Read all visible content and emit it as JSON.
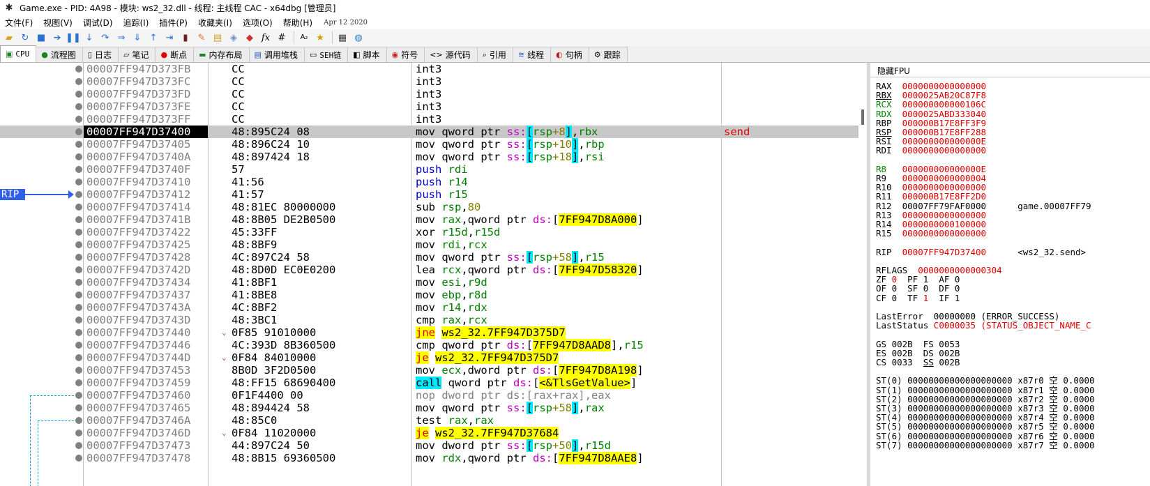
{
  "window": {
    "title": "Game.exe - PID: 4A98 - 模块: ws2_32.dll - 线程: 主线程 CAC - x64dbg [管理员]"
  },
  "menu": {
    "items": [
      "文件(F)",
      "视图(V)",
      "调试(D)",
      "追踪(I)",
      "插件(P)",
      "收藏夹(I)",
      "选项(O)",
      "帮助(H)"
    ],
    "date": "Apr 12 2020"
  },
  "toolbar": {
    "icons": [
      "open-icon",
      "restart-icon",
      "stop-icon",
      "run-icon",
      "pause-icon",
      "step-into-icon",
      "step-over-icon",
      "trace-into-icon",
      "trace-over-icon",
      "run-to-return-icon",
      "run-to-user-icon",
      "patch-icon",
      "comment-icon",
      "label-icon",
      "bookmark-icon",
      "function-icon",
      "hash-icon",
      "font-icon",
      "favourite-icon",
      "calculator-icon",
      "globe-icon"
    ],
    "glyph_fx": "fx",
    "glyph_hash": "#"
  },
  "tabs": [
    {
      "label": "CPU",
      "icon": "cpu-icon",
      "active": true
    },
    {
      "label": "流程图",
      "icon": "graph-icon"
    },
    {
      "label": "日志",
      "icon": "log-icon"
    },
    {
      "label": "笔记",
      "icon": "notes-icon"
    },
    {
      "label": "断点",
      "icon": "breakpoint-icon"
    },
    {
      "label": "内存布局",
      "icon": "memory-icon"
    },
    {
      "label": "调用堆栈",
      "icon": "callstack-icon"
    },
    {
      "label": "SEH链",
      "icon": "seh-icon"
    },
    {
      "label": "脚本",
      "icon": "script-icon"
    },
    {
      "label": "符号",
      "icon": "symbols-icon"
    },
    {
      "label": "源代码",
      "icon": "source-icon"
    },
    {
      "label": "引用",
      "icon": "references-icon"
    },
    {
      "label": "线程",
      "icon": "threads-icon"
    },
    {
      "label": "句柄",
      "icon": "handles-icon"
    },
    {
      "label": "跟踪",
      "icon": "trace-icon"
    }
  ],
  "disasm": {
    "rip_label": "RIP",
    "rows": [
      {
        "addr": "00007FF947D373FB",
        "bytes": "CC",
        "asm": [
          [
            "k-mov",
            "int3"
          ]
        ]
      },
      {
        "addr": "00007FF947D373FC",
        "bytes": "CC",
        "asm": [
          [
            "k-mov",
            "int3"
          ]
        ]
      },
      {
        "addr": "00007FF947D373FD",
        "bytes": "CC",
        "asm": [
          [
            "k-mov",
            "int3"
          ]
        ]
      },
      {
        "addr": "00007FF947D373FE",
        "bytes": "CC",
        "asm": [
          [
            "k-mov",
            "int3"
          ]
        ]
      },
      {
        "addr": "00007FF947D373FF",
        "bytes": "CC",
        "asm": [
          [
            "k-mov",
            "int3"
          ]
        ]
      },
      {
        "addr": "00007FF947D37400",
        "bytes": "48:895C24 08",
        "rip": true,
        "comment": "send",
        "asm": [
          [
            "k-mov",
            "mov qword ptr "
          ],
          [
            "seg",
            "ss:"
          ],
          [
            "brk",
            "["
          ],
          [
            "reg",
            "rsp"
          ],
          [
            "num",
            "+8"
          ],
          [
            "brk",
            "]"
          ],
          [
            "k-mov",
            ","
          ],
          [
            "reg",
            "rbx"
          ]
        ]
      },
      {
        "addr": "00007FF947D37405",
        "bytes": "48:896C24 10",
        "asm": [
          [
            "k-mov",
            "mov qword ptr "
          ],
          [
            "seg",
            "ss:"
          ],
          [
            "brk",
            "["
          ],
          [
            "reg",
            "rsp"
          ],
          [
            "num",
            "+10"
          ],
          [
            "brk",
            "]"
          ],
          [
            "k-mov",
            ","
          ],
          [
            "reg",
            "rbp"
          ]
        ]
      },
      {
        "addr": "00007FF947D3740A",
        "bytes": "48:897424 18",
        "asm": [
          [
            "k-mov",
            "mov qword ptr "
          ],
          [
            "seg",
            "ss:"
          ],
          [
            "brk",
            "["
          ],
          [
            "reg",
            "rsp"
          ],
          [
            "num",
            "+18"
          ],
          [
            "brk",
            "]"
          ],
          [
            "k-mov",
            ","
          ],
          [
            "reg",
            "rsi"
          ]
        ]
      },
      {
        "addr": "00007FF947D3740F",
        "bytes": "57",
        "asm": [
          [
            "k-push",
            "push "
          ],
          [
            "reg",
            "rdi"
          ]
        ]
      },
      {
        "addr": "00007FF947D37410",
        "bytes": "41:56",
        "asm": [
          [
            "k-push",
            "push "
          ],
          [
            "reg",
            "r14"
          ]
        ]
      },
      {
        "addr": "00007FF947D37412",
        "bytes": "41:57",
        "asm": [
          [
            "k-push",
            "push "
          ],
          [
            "reg",
            "r15"
          ]
        ]
      },
      {
        "addr": "00007FF947D37414",
        "bytes": "48:81EC 80000000",
        "asm": [
          [
            "k-mov",
            "sub "
          ],
          [
            "reg",
            "rsp"
          ],
          [
            "k-mov",
            ","
          ],
          [
            "num",
            "80"
          ]
        ]
      },
      {
        "addr": "00007FF947D3741B",
        "bytes": "48:8B05 DE2B0500",
        "asm": [
          [
            "k-mov",
            "mov "
          ],
          [
            "reg",
            "rax"
          ],
          [
            "k-mov",
            ",qword ptr "
          ],
          [
            "seg",
            "ds:"
          ],
          [
            "k-mov",
            "["
          ],
          [
            "yel",
            "7FF947D8A000"
          ],
          [
            "k-mov",
            "]"
          ]
        ]
      },
      {
        "addr": "00007FF947D37422",
        "bytes": "45:33FF",
        "asm": [
          [
            "k-mov",
            "xor "
          ],
          [
            "reg",
            "r15d"
          ],
          [
            "k-mov",
            ","
          ],
          [
            "reg",
            "r15d"
          ]
        ]
      },
      {
        "addr": "00007FF947D37425",
        "bytes": "48:8BF9",
        "asm": [
          [
            "k-mov",
            "mov "
          ],
          [
            "reg",
            "rdi"
          ],
          [
            "k-mov",
            ","
          ],
          [
            "reg",
            "rcx"
          ]
        ]
      },
      {
        "addr": "00007FF947D37428",
        "bytes": "4C:897C24 58",
        "asm": [
          [
            "k-mov",
            "mov qword ptr "
          ],
          [
            "seg",
            "ss:"
          ],
          [
            "brk",
            "["
          ],
          [
            "reg",
            "rsp"
          ],
          [
            "num",
            "+58"
          ],
          [
            "brk",
            "]"
          ],
          [
            "k-mov",
            ","
          ],
          [
            "reg",
            "r15"
          ]
        ]
      },
      {
        "addr": "00007FF947D3742D",
        "bytes": "48:8D0D EC0E0200",
        "asm": [
          [
            "k-mov",
            "lea "
          ],
          [
            "reg",
            "rcx"
          ],
          [
            "k-mov",
            ",qword ptr "
          ],
          [
            "seg",
            "ds:"
          ],
          [
            "k-mov",
            "["
          ],
          [
            "yel",
            "7FF947D58320"
          ],
          [
            "k-mov",
            "]"
          ]
        ]
      },
      {
        "addr": "00007FF947D37434",
        "bytes": "41:8BF1",
        "asm": [
          [
            "k-mov",
            "mov "
          ],
          [
            "reg",
            "esi"
          ],
          [
            "k-mov",
            ","
          ],
          [
            "reg",
            "r9d"
          ]
        ]
      },
      {
        "addr": "00007FF947D37437",
        "bytes": "41:8BE8",
        "asm": [
          [
            "k-mov",
            "mov "
          ],
          [
            "reg",
            "ebp"
          ],
          [
            "k-mov",
            ","
          ],
          [
            "reg",
            "r8d"
          ]
        ]
      },
      {
        "addr": "00007FF947D3743A",
        "bytes": "4C:8BF2",
        "asm": [
          [
            "k-mov",
            "mov "
          ],
          [
            "reg",
            "r14"
          ],
          [
            "k-mov",
            ","
          ],
          [
            "reg",
            "rdx"
          ]
        ]
      },
      {
        "addr": "00007FF947D3743D",
        "bytes": "48:3BC1",
        "asm": [
          [
            "k-mov",
            "cmp "
          ],
          [
            "reg",
            "rax"
          ],
          [
            "k-mov",
            ","
          ],
          [
            "reg",
            "rcx"
          ]
        ]
      },
      {
        "addr": "00007FF947D37440",
        "bytes": "0F85 91010000",
        "jump": true,
        "asm": [
          [
            "k-jmp",
            "jne"
          ],
          [
            "k-dx",
            " "
          ],
          [
            "dest",
            "ws2_32.7FF947D375D7"
          ]
        ]
      },
      {
        "addr": "00007FF947D37446",
        "bytes": "4C:393D 8B360500",
        "asm": [
          [
            "k-mov",
            "cmp qword ptr "
          ],
          [
            "seg",
            "ds:"
          ],
          [
            "k-mov",
            "["
          ],
          [
            "yel",
            "7FF947D8AAD8"
          ],
          [
            "k-mov",
            "],"
          ],
          [
            "reg",
            "r15"
          ]
        ]
      },
      {
        "addr": "00007FF947D3744D",
        "bytes": "0F84 84010000",
        "jump": true,
        "asm": [
          [
            "k-jmp",
            "je"
          ],
          [
            "k-dx",
            " "
          ],
          [
            "dest",
            "ws2_32.7FF947D375D7"
          ]
        ]
      },
      {
        "addr": "00007FF947D37453",
        "bytes": "8B0D 3F2D0500",
        "asm": [
          [
            "k-mov",
            "mov "
          ],
          [
            "reg",
            "ecx"
          ],
          [
            "k-mov",
            ",dword ptr "
          ],
          [
            "seg",
            "ds:"
          ],
          [
            "k-mov",
            "["
          ],
          [
            "yel",
            "7FF947D8A198"
          ],
          [
            "k-mov",
            "]"
          ]
        ]
      },
      {
        "addr": "00007FF947D37459",
        "bytes": "48:FF15 68690400",
        "asm": [
          [
            "k-call",
            "call"
          ],
          [
            "k-mov",
            " qword ptr "
          ],
          [
            "seg",
            "ds:"
          ],
          [
            "k-mov",
            "["
          ],
          [
            "yel",
            "<&TlsGetValue>"
          ],
          [
            "k-mov",
            "]"
          ]
        ]
      },
      {
        "addr": "00007FF947D37460",
        "bytes": "0F1F4400 00",
        "asm": [
          [
            "k-nop",
            "nop dword ptr ds:[rax+rax],eax"
          ]
        ]
      },
      {
        "addr": "00007FF947D37465",
        "bytes": "48:894424 58",
        "asm": [
          [
            "k-mov",
            "mov qword ptr "
          ],
          [
            "seg",
            "ss:"
          ],
          [
            "brk",
            "["
          ],
          [
            "reg",
            "rsp"
          ],
          [
            "num",
            "+58"
          ],
          [
            "brk",
            "]"
          ],
          [
            "k-mov",
            ","
          ],
          [
            "reg",
            "rax"
          ]
        ]
      },
      {
        "addr": "00007FF947D3746A",
        "bytes": "48:85C0",
        "asm": [
          [
            "k-mov",
            "test "
          ],
          [
            "reg",
            "rax"
          ],
          [
            "k-mov",
            ","
          ],
          [
            "reg",
            "rax"
          ]
        ]
      },
      {
        "addr": "00007FF947D3746D",
        "bytes": "0F84 11020000",
        "jump": true,
        "asm": [
          [
            "k-jmp",
            "je"
          ],
          [
            "k-dx",
            " "
          ],
          [
            "dest",
            "ws2_32.7FF947D37684"
          ]
        ]
      },
      {
        "addr": "00007FF947D37473",
        "bytes": "44:897C24 50",
        "asm": [
          [
            "k-mov",
            "mov dword ptr "
          ],
          [
            "seg",
            "ss:"
          ],
          [
            "brk",
            "["
          ],
          [
            "reg",
            "rsp"
          ],
          [
            "num",
            "+50"
          ],
          [
            "brk",
            "]"
          ],
          [
            "k-mov",
            ","
          ],
          [
            "reg",
            "r15d"
          ]
        ]
      },
      {
        "addr": "00007FF947D37478",
        "bytes": "48:8B15 69360500",
        "asm": [
          [
            "k-mov",
            "mov "
          ],
          [
            "reg",
            "rdx"
          ],
          [
            "k-mov",
            ",qword ptr "
          ],
          [
            "seg",
            "ds:"
          ],
          [
            "k-mov",
            "["
          ],
          [
            "yel",
            "7FF947D8AAE8"
          ],
          [
            "k-mov",
            "]"
          ]
        ]
      }
    ]
  },
  "registers": {
    "header": "隐藏FPU",
    "lines": [
      [
        [
          "rk",
          "RAX  "
        ],
        [
          "rv",
          "0000000000000000"
        ]
      ],
      [
        [
          "rk ul",
          "RBX"
        ],
        [
          "rk",
          "  "
        ],
        [
          "rv",
          "0000025AB20C87F8"
        ]
      ],
      [
        [
          "rg",
          "RCX"
        ],
        [
          "rk",
          "  "
        ],
        [
          "rv",
          "000000000000106C"
        ]
      ],
      [
        [
          "rg",
          "RDX"
        ],
        [
          "rk",
          "  "
        ],
        [
          "rv",
          "0000025ABD333040"
        ]
      ],
      [
        [
          "rk",
          "RBP  "
        ],
        [
          "rv",
          "000000B17E8FF3F9"
        ]
      ],
      [
        [
          "rk ul",
          "RSP"
        ],
        [
          "rk",
          "  "
        ],
        [
          "rv",
          "000000B17E8FF288"
        ]
      ],
      [
        [
          "rk",
          "RSI  "
        ],
        [
          "rv",
          "000000000000000E"
        ]
      ],
      [
        [
          "rk",
          "RDI  "
        ],
        [
          "rv",
          "0000000000000000"
        ]
      ],
      [
        [
          "rk",
          " "
        ]
      ],
      [
        [
          "rg",
          "R8"
        ],
        [
          "rk",
          "   "
        ],
        [
          "rv",
          "000000000000000E"
        ]
      ],
      [
        [
          "rk",
          "R9   "
        ],
        [
          "rv",
          "0000000000000004"
        ]
      ],
      [
        [
          "rk",
          "R10  "
        ],
        [
          "rv",
          "0000000000000000"
        ]
      ],
      [
        [
          "rk",
          "R11  "
        ],
        [
          "rv",
          "000000B17E8FF2D0"
        ]
      ],
      [
        [
          "rk",
          "R12  00007FF79FAF0000      game.00007FF79"
        ]
      ],
      [
        [
          "rk",
          "R13  "
        ],
        [
          "rv",
          "0000000000000000"
        ]
      ],
      [
        [
          "rk",
          "R14  "
        ],
        [
          "rv",
          "0000000000100000"
        ]
      ],
      [
        [
          "rk",
          "R15  "
        ],
        [
          "rv",
          "0000000000000000"
        ]
      ],
      [
        [
          "rk",
          " "
        ]
      ],
      [
        [
          "rk",
          "RIP  "
        ],
        [
          "rv",
          "00007FF947D37400"
        ],
        [
          "rk",
          "      <ws2_32.send>"
        ]
      ],
      [
        [
          "rk",
          " "
        ]
      ],
      [
        [
          "rk",
          "RFLAGS  "
        ],
        [
          "rv",
          "0000000000000304"
        ]
      ],
      [
        [
          "rk",
          "ZF "
        ],
        [
          "rv",
          "0"
        ],
        [
          "rk",
          "  PF 1  AF 0"
        ]
      ],
      [
        [
          "rk",
          "OF 0  SF 0  DF 0"
        ]
      ],
      [
        [
          "rk",
          "CF 0  TF "
        ],
        [
          "rv",
          "1"
        ],
        [
          "rk",
          "  IF 1"
        ]
      ],
      [
        [
          "rk",
          " "
        ]
      ],
      [
        [
          "rk",
          "LastError  00000000 (ERROR_SUCCESS)"
        ]
      ],
      [
        [
          "rk",
          "LastStatus "
        ],
        [
          "rv",
          "C0000035 (STATUS_OBJECT_NAME_C"
        ]
      ],
      [
        [
          "rk",
          " "
        ]
      ],
      [
        [
          "rk",
          "GS 002B  FS 0053"
        ]
      ],
      [
        [
          "rk",
          "ES 002B  DS 002B"
        ]
      ],
      [
        [
          "rk",
          "CS 0033  "
        ],
        [
          "rk ul",
          "SS"
        ],
        [
          "rk",
          " 002B"
        ]
      ],
      [
        [
          "rk",
          " "
        ]
      ],
      [
        [
          "rk",
          "ST(0) 00000000000000000000 x87r0 空 0.0000"
        ]
      ],
      [
        [
          "rk",
          "ST(1) 00000000000000000000 x87r1 空 0.0000"
        ]
      ],
      [
        [
          "rk",
          "ST(2) 00000000000000000000 x87r2 空 0.0000"
        ]
      ],
      [
        [
          "rk",
          "ST(3) 00000000000000000000 x87r3 空 0.0000"
        ]
      ],
      [
        [
          "rk",
          "ST(4) 00000000000000000000 x87r4 空 0.0000"
        ]
      ],
      [
        [
          "rk",
          "ST(5) 00000000000000000000 x87r5 空 0.0000"
        ]
      ],
      [
        [
          "rk",
          "ST(6) 00000000000000000000 x87r6 空 0.0000"
        ]
      ],
      [
        [
          "rk",
          "ST(7) 00000000000000000000 x87r7 空 0.0000"
        ]
      ]
    ]
  },
  "colors": {
    "rip_highlight": "#c8c8c8",
    "rip_arrow": "#3060e8",
    "jump_highlight": "#ffff00",
    "call_highlight": "#00e8ff",
    "register_value": "#e00000"
  }
}
